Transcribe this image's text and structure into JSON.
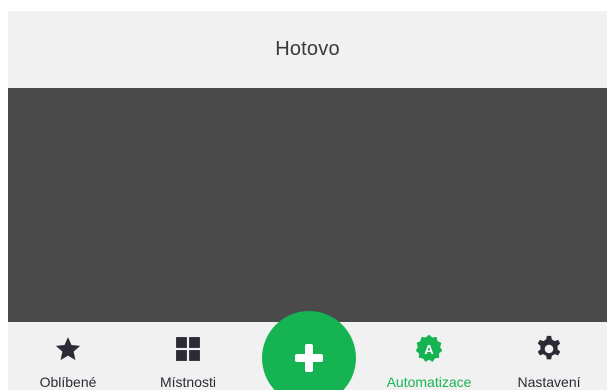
{
  "header": {
    "title": "Hotovo"
  },
  "bottom_nav": {
    "items": [
      {
        "label": "Oblíbené",
        "icon": "star-icon",
        "active": false
      },
      {
        "label": "Místnosti",
        "icon": "grid-icon",
        "active": false
      },
      {
        "label": "Automatizace",
        "icon": "automation-badge-icon",
        "active": true
      },
      {
        "label": "Nastavení",
        "icon": "gear-icon",
        "active": false
      }
    ],
    "badge_letter": "A"
  },
  "fab": {
    "icon": "plus-icon"
  },
  "colors": {
    "accent": "#16b352",
    "header_bg": "#f1f1f1",
    "content_bg": "#4a4a4a",
    "nav_bg": "#f1f1f1",
    "icon_dark": "#2b2b36"
  }
}
